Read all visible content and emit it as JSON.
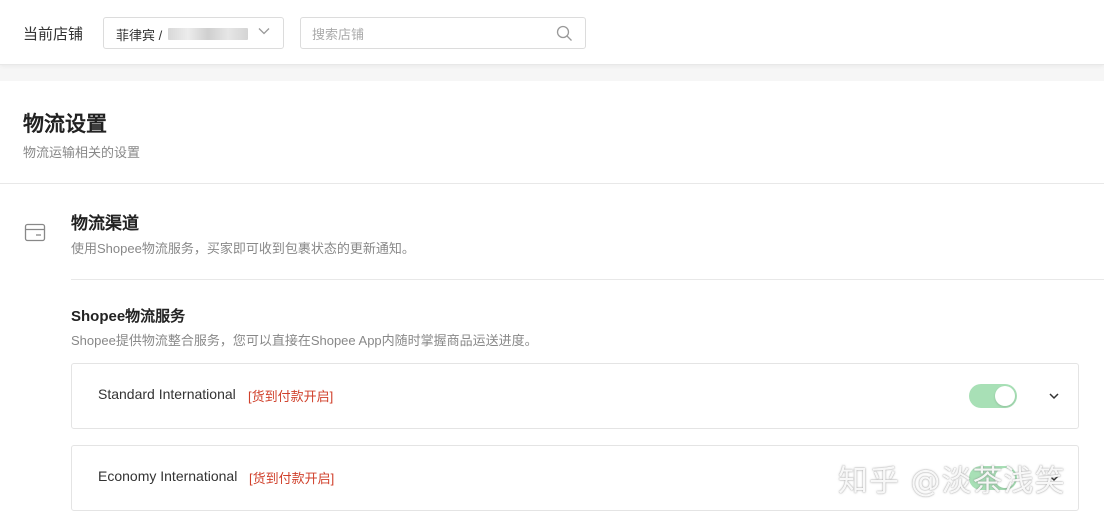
{
  "header": {
    "shop_label": "当前店铺",
    "shop_select_value": "菲律宾 /",
    "search_placeholder": "搜索店铺"
  },
  "page": {
    "title": "物流设置",
    "subtitle": "物流运输相关的设置"
  },
  "section": {
    "title": "物流渠道",
    "subtitle": "使用Shopee物流服务，买家即可收到包裹状态的更新通知。"
  },
  "service": {
    "title": "Shopee物流服务",
    "subtitle": "Shopee提供物流整合服务，您可以直接在Shopee App内随时掌握商品运送进度。"
  },
  "channels": [
    {
      "name": "Standard International",
      "cod": "[货到付款开启]",
      "enabled": true
    },
    {
      "name": "Economy International",
      "cod": "[货到付款开启]",
      "enabled": true
    }
  ],
  "watermark": "知乎 @淡茶浅笑",
  "colors": {
    "toggle_on": "#a8e0b6",
    "cod_red": "#d0402b"
  }
}
